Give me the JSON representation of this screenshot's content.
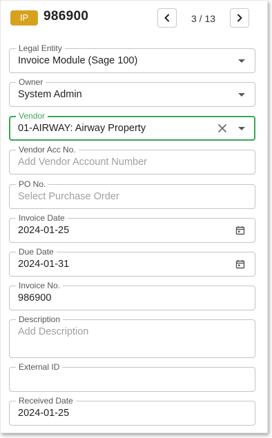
{
  "header": {
    "badge": "IP",
    "invoice_number": "986900",
    "counter": "3 / 13",
    "prev_icon": "chevron-left-icon",
    "next_icon": "chevron-right-icon",
    "badge_color": "#d6a21e"
  },
  "fields": {
    "legal_entity": {
      "label": "Legal Entity",
      "value": "Invoice Module (Sage 100)"
    },
    "owner": {
      "label": "Owner",
      "value": "System Admin"
    },
    "vendor": {
      "label": "Vendor",
      "value": "01-AIRWAY: Airway Property"
    },
    "vendor_acc_no": {
      "label": "Vendor Acc No.",
      "placeholder": "Add Vendor Account Number"
    },
    "po_no": {
      "label": "PO No.",
      "placeholder": "Select Purchase Order"
    },
    "invoice_date": {
      "label": "Invoice Date",
      "value": "2024-01-25"
    },
    "due_date": {
      "label": "Due Date",
      "value": "2024-01-31"
    },
    "invoice_no": {
      "label": "Invoice No.",
      "value": "986900"
    },
    "description": {
      "label": "Description",
      "placeholder": "Add Description"
    },
    "external_id": {
      "label": "External ID",
      "value": ""
    },
    "received_date": {
      "label": "Received Date",
      "value": "2024-01-25"
    }
  },
  "colors": {
    "focus": "#3aa655",
    "border": "#c4c4c4",
    "placeholder": "#a0a0a0"
  }
}
